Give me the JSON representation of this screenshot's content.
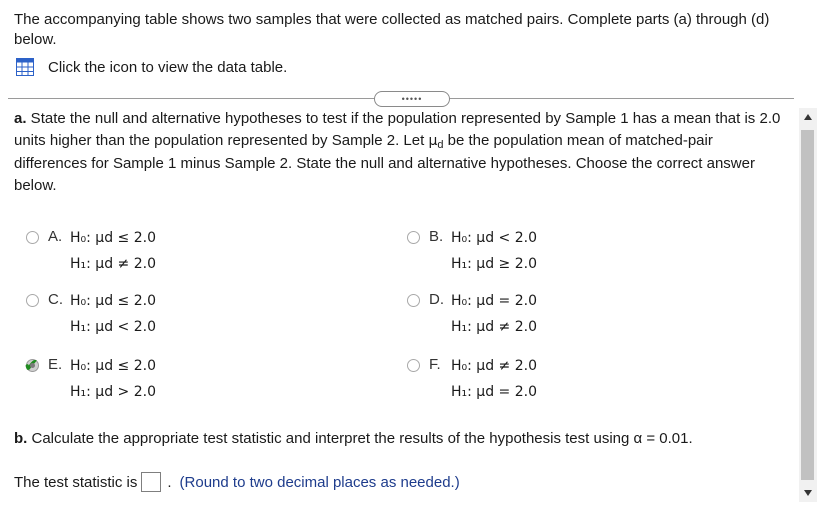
{
  "intro": "The accompanying table shows two samples that were collected as matched pairs. Complete parts (a) through (d) below.",
  "data_link": "Click the icon to view the data table.",
  "expander_dots": "•••••",
  "part_a": {
    "label": "a.",
    "text_before": " State the null and alternative hypotheses to test if the population represented by Sample 1 has a mean that is 2.0 units higher than the population represented by Sample 2. Let ",
    "mu": "μ",
    "mu_sub": "d",
    "text_after": " be the population mean of matched-pair differences for Sample 1 minus Sample 2. State the null and alternative hypotheses. Choose the correct answer below."
  },
  "options": [
    {
      "letter": "A.",
      "h0": "H₀: μd ≤ 2.0",
      "h1": "H₁: μd ≠ 2.0",
      "selected": false
    },
    {
      "letter": "B.",
      "h0": "H₀: μd < 2.0",
      "h1": "H₁: μd ≥ 2.0",
      "selected": false
    },
    {
      "letter": "C.",
      "h0": "H₀: μd ≤ 2.0",
      "h1": "H₁: μd < 2.0",
      "selected": false
    },
    {
      "letter": "D.",
      "h0": "H₀: μd = 2.0",
      "h1": "H₁: μd ≠ 2.0",
      "selected": false
    },
    {
      "letter": "E.",
      "h0": "H₀: μd ≤ 2.0",
      "h1": "H₁: μd > 2.0",
      "selected": true
    },
    {
      "letter": "F.",
      "h0": "H₀: μd ≠ 2.0",
      "h1": "H₁: μd = 2.0",
      "selected": false
    }
  ],
  "part_b": {
    "label": "b.",
    "text": " Calculate the appropriate test statistic and interpret the results of the hypothesis test using α = 0.01."
  },
  "test_stat": {
    "prefix": "The test statistic is",
    "value": "",
    "suffix": ".",
    "hint": "(Round to two decimal places as needed.)"
  },
  "colors": {
    "hint": "#1e3c8c",
    "check": "#1f8a1f",
    "icon": "#2d62c8"
  },
  "icons": {
    "data_table": "table-grid-icon",
    "check": "checkmark-icon"
  }
}
